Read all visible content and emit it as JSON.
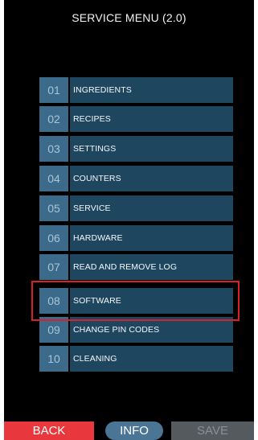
{
  "title": "SERVICE MENU (2.0)",
  "menu": [
    {
      "num": "01",
      "label": "INGREDIENTS"
    },
    {
      "num": "02",
      "label": "RECIPES"
    },
    {
      "num": "03",
      "label": "SETTINGS"
    },
    {
      "num": "04",
      "label": "COUNTERS"
    },
    {
      "num": "05",
      "label": "SERVICE"
    },
    {
      "num": "06",
      "label": "HARDWARE"
    },
    {
      "num": "07",
      "label": "READ AND REMOVE LOG"
    },
    {
      "num": "08",
      "label": "SOFTWARE"
    },
    {
      "num": "09",
      "label": "CHANGE PIN CODES"
    },
    {
      "num": "10",
      "label": "CLEANING"
    }
  ],
  "highlighted_item": "08",
  "buttons": {
    "back": "BACK",
    "info": "INFO",
    "save": "SAVE",
    "save_enabled": false
  },
  "colors": {
    "number_cell": "#3c6a8b",
    "label_cell": "#1f465f",
    "highlight_border": "#d8202a",
    "back_button": "#e8383d",
    "info_button": "#4b7594",
    "save_button_disabled": "#555a5f"
  }
}
